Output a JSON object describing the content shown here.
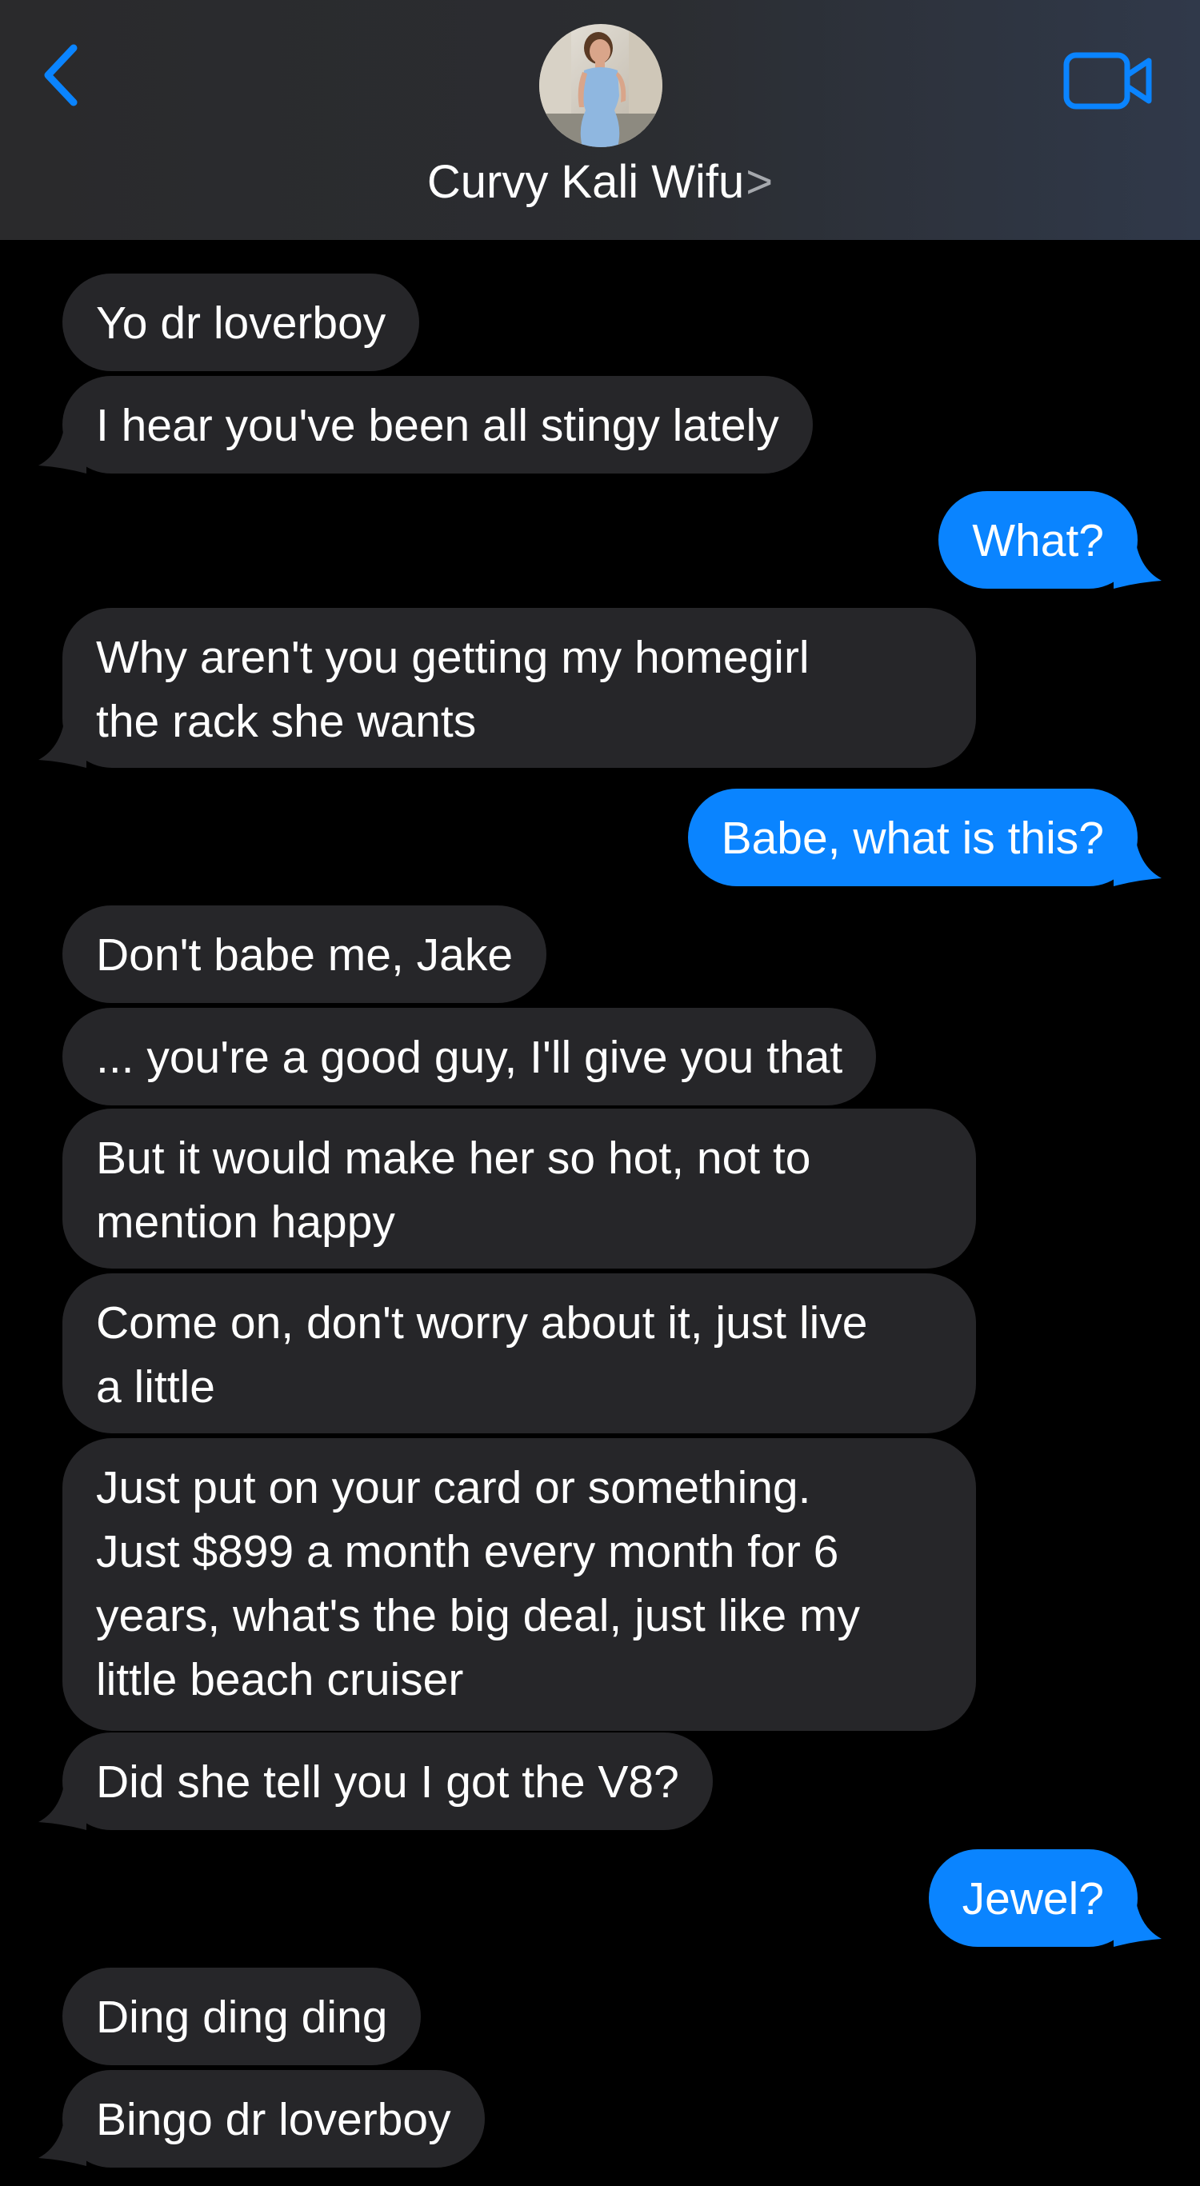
{
  "header": {
    "contact_name": "Curvy Kali Wifu",
    "contact_chevron": ">",
    "back_icon": "chevron-left-icon",
    "video_icon": "video-camera-icon",
    "accent_color": "#0a84ff"
  },
  "messages": [
    {
      "direction": "incoming",
      "text": "Yo dr loverboy"
    },
    {
      "direction": "incoming",
      "text": "I hear you've been all stingy lately"
    },
    {
      "direction": "outgoing",
      "text": "What?"
    },
    {
      "direction": "incoming",
      "text": "Why aren't you getting my homegirl\nthe rack she wants"
    },
    {
      "direction": "outgoing",
      "text": "Babe, what is this?"
    },
    {
      "direction": "incoming",
      "text": "Don't babe me, Jake"
    },
    {
      "direction": "incoming",
      "text": "... you're a good guy, I'll give you that"
    },
    {
      "direction": "incoming",
      "text": "But it would make her so hot, not to\nmention happy"
    },
    {
      "direction": "incoming",
      "text": "Come on, don't worry about it, just live\na little"
    },
    {
      "direction": "incoming",
      "text": "Just put on your card or something.\nJust $899 a month every month for 6\nyears, what's the big deal, just like my\nlittle beach cruiser"
    },
    {
      "direction": "incoming",
      "text": "Did she tell you I got the V8?"
    },
    {
      "direction": "outgoing",
      "text": "Jewel?"
    },
    {
      "direction": "incoming",
      "text": "Ding ding ding"
    },
    {
      "direction": "incoming",
      "text": "Bingo dr loverboy"
    }
  ]
}
